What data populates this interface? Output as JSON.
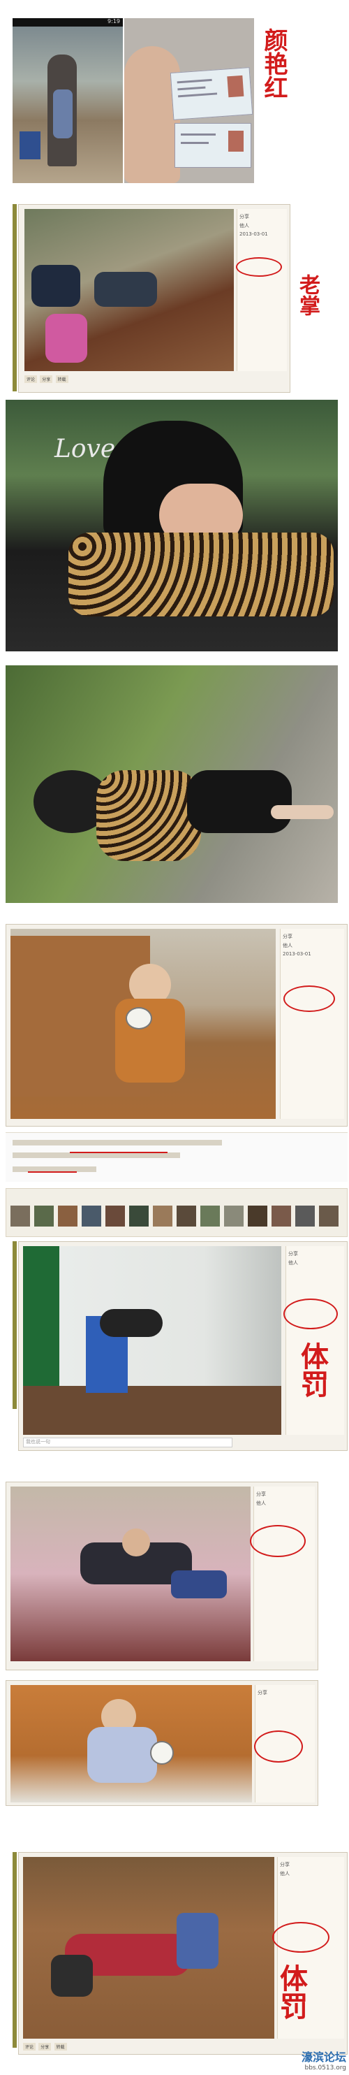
{
  "phone_status": {
    "time": "9:19"
  },
  "id_card_annotation": "颜艳红",
  "teacher_annotation": "老掌",
  "love_watermark": "Love",
  "punishment_annotation": "体罚",
  "sidebar_labels": {
    "share": "分享",
    "others": "他人",
    "date": "2013-03-01"
  },
  "comment_bar": {
    "placeholder": "我也说一句",
    "actions": [
      "评论",
      "分享",
      "转载"
    ]
  },
  "footer": {
    "watermark": "濠滨论坛",
    "url": "bbs.0513.org"
  },
  "colors": {
    "annotation_red": "#d21b1b",
    "accent_olive": "#8d8a3a"
  }
}
